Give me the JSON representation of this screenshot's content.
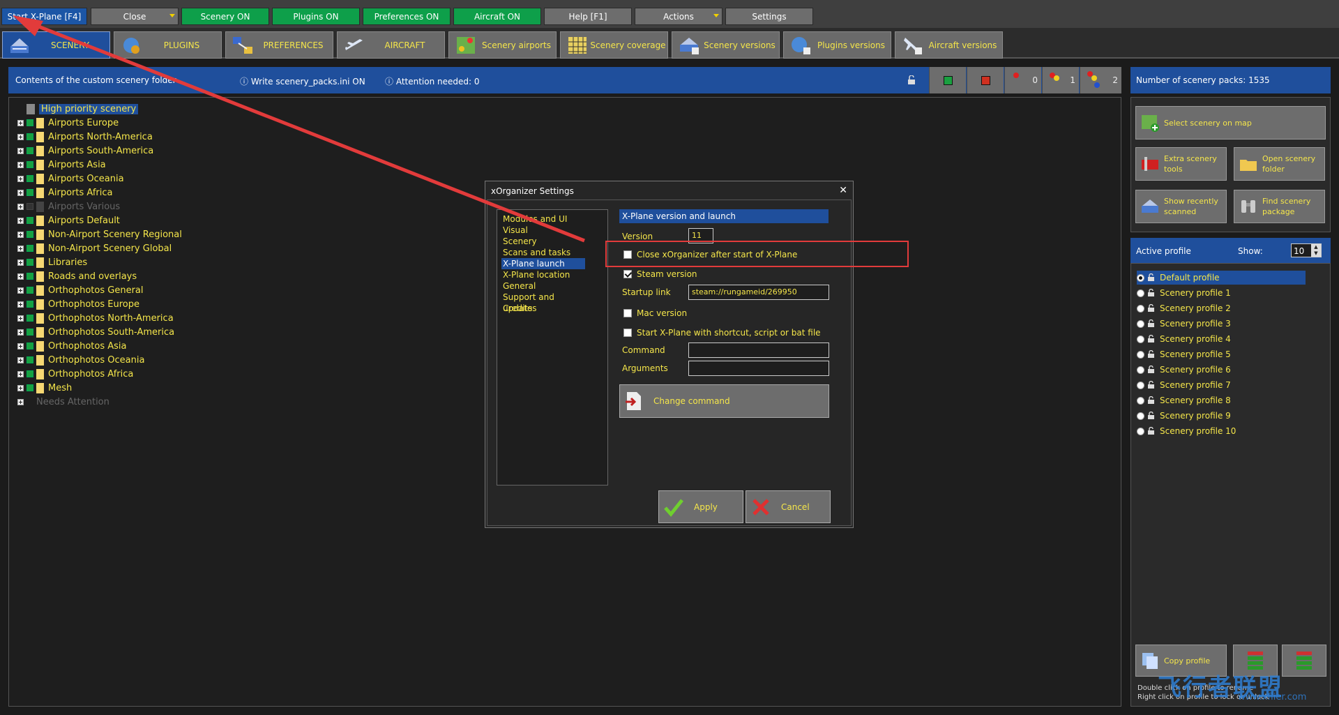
{
  "toolbar": {
    "start": "Start X-Plane [F4]",
    "close": "Close",
    "scenery_on": "Scenery ON",
    "plugins_on": "Plugins ON",
    "preferences_on": "Preferences ON",
    "aircraft_on": "Aircraft ON",
    "help": "Help [F1]",
    "actions": "Actions",
    "settings": "Settings"
  },
  "tabs": [
    {
      "label": "SCENERY",
      "icon": "scenery-icon"
    },
    {
      "label": "PLUGINS",
      "icon": "plugins-icon"
    },
    {
      "label": "PREFERENCES",
      "icon": "preferences-icon"
    },
    {
      "label": "AIRCRAFT",
      "icon": "aircraft-icon"
    },
    {
      "label": "Scenery airports",
      "icon": "scenery-airports-icon"
    },
    {
      "label": "Scenery coverage",
      "icon": "scenery-coverage-icon"
    },
    {
      "label": "Scenery versions",
      "icon": "scenery-versions-icon"
    },
    {
      "label": "Plugins versions",
      "icon": "plugins-versions-icon"
    },
    {
      "label": "Aircraft versions",
      "icon": "aircraft-versions-icon"
    }
  ],
  "header": {
    "contents": "Contents of the custom scenery folder",
    "write": "Write scenery_packs.ini ON",
    "attention": "Attention needed: 0",
    "count0": "0",
    "count1": "1",
    "count2": "2"
  },
  "tree": [
    {
      "label": "High priority scenery",
      "selected": true
    },
    {
      "label": "Airports Europe"
    },
    {
      "label": "Airports North-America"
    },
    {
      "label": "Airports South-America"
    },
    {
      "label": "Airports Asia"
    },
    {
      "label": "Airports Oceania"
    },
    {
      "label": "Airports Africa"
    },
    {
      "label": "Airports Various",
      "dim": true
    },
    {
      "label": "Airports Default"
    },
    {
      "label": "Non-Airport Scenery Regional"
    },
    {
      "label": "Non-Airport Scenery Global"
    },
    {
      "label": "Libraries"
    },
    {
      "label": "Roads and overlays"
    },
    {
      "label": "Orthophotos General"
    },
    {
      "label": "Orthophotos Europe"
    },
    {
      "label": "Orthophotos North-America"
    },
    {
      "label": "Orthophotos South-America"
    },
    {
      "label": "Orthophotos Asia"
    },
    {
      "label": "Orthophotos Oceania"
    },
    {
      "label": "Orthophotos Africa"
    },
    {
      "label": "Mesh"
    },
    {
      "label": "Needs Attention",
      "dim": true
    }
  ],
  "right": {
    "count": "Number of scenery packs: 1535",
    "select_map": "Select scenery on map",
    "extra_tools_1": "Extra scenery",
    "extra_tools_2": "tools",
    "open_folder_1": "Open scenery",
    "open_folder_2": "folder",
    "recent_1": "Show recently",
    "recent_2": "scanned",
    "find_1": "Find scenery",
    "find_2": "package",
    "active_profile": "Active profile",
    "show": "Show:",
    "show_value": "10",
    "profiles": [
      "Default profile",
      "Scenery profile 1",
      "Scenery profile 2",
      "Scenery profile 3",
      "Scenery profile 4",
      "Scenery profile 5",
      "Scenery profile 6",
      "Scenery profile 7",
      "Scenery profile 8",
      "Scenery profile 9",
      "Scenery profile 10"
    ],
    "copy_profile": "Copy profile",
    "hint1": "Double click on profile to rename",
    "hint2": "Right click on profile to lock or unlock"
  },
  "dialog": {
    "title": "xOrganizer Settings",
    "nav": [
      "Modules and UI",
      "Visual",
      "Scenery",
      "Scans and tasks",
      "X-Plane launch",
      "X-Plane location",
      "General",
      "Support and updates",
      "Credits"
    ],
    "section": "X-Plane version and launch",
    "version_label": "Version",
    "version_value": "11",
    "close_after": "Close xOrganizer after start of X-Plane",
    "steam": "Steam version",
    "startup_label": "Startup link",
    "startup_value": "steam://rungameid/269950",
    "mac": "Mac version",
    "shortcut": "Start X-Plane with shortcut, script or bat file",
    "command_label": "Command",
    "arguments_label": "Arguments",
    "change_command": "Change command",
    "apply": "Apply",
    "cancel": "Cancel"
  },
  "watermark": "飞行者联盟",
  "watermark_sub": "www.xflier.com",
  "colors": {
    "accent_blue": "#1f4f9c",
    "green": "#0e9f4a",
    "label_yellow": "#f5e64a",
    "annotation_red": "#e23b3b"
  }
}
